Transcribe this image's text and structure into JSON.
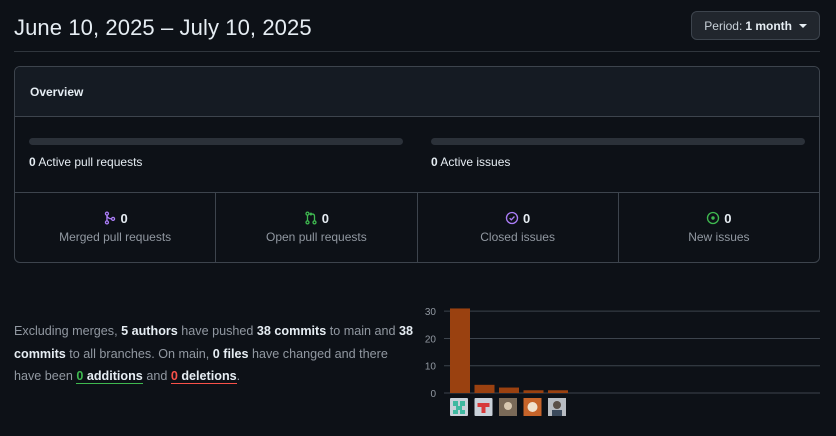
{
  "header": {
    "date_range": "June 10, 2025 – July 10, 2025",
    "period_label": "Period:",
    "period_value": "1 month"
  },
  "overview": {
    "title": "Overview",
    "active_pull_requests": {
      "count": "0",
      "label": "Active pull requests",
      "progress": 0
    },
    "active_issues": {
      "count": "0",
      "label": "Active issues",
      "progress": 0
    },
    "stats": [
      {
        "icon": "git-merge-icon",
        "color": "#ab7df8",
        "count": "0",
        "label": "Merged pull requests"
      },
      {
        "icon": "git-pull-request-icon",
        "color": "#3fb950",
        "count": "0",
        "label": "Open pull requests"
      },
      {
        "icon": "issue-closed-icon",
        "color": "#ab7df8",
        "count": "0",
        "label": "Closed issues"
      },
      {
        "icon": "issue-opened-icon",
        "color": "#3fb950",
        "count": "0",
        "label": "New issues"
      }
    ]
  },
  "summary": {
    "p1": "Excluding merges, ",
    "authors": "5 authors",
    "p2": " have pushed ",
    "commits_main": "38 commits",
    "p3": " to main and ",
    "commits_all": "38 commits",
    "p4": " to all branches. On main, ",
    "files": "0 files",
    "p5": " have changed and there have been ",
    "additions_n": "0",
    "additions_l": " additions",
    "p6": " and ",
    "deletions_n": "0",
    "deletions_l": " deletions",
    "p7": "."
  },
  "colors": {
    "bar": "#9a4110",
    "grid": "#3d444d",
    "tick": "#9198a1"
  },
  "chart_data": {
    "type": "bar",
    "categories": [
      "author-1",
      "author-2",
      "author-3",
      "author-4",
      "author-5"
    ],
    "values": [
      31,
      3,
      2,
      1,
      1
    ],
    "yticks": [
      0,
      10,
      20,
      30
    ],
    "ylim": [
      0,
      33
    ],
    "xlabel": "",
    "ylabel": "",
    "grid": true,
    "avatars": [
      "identicon-avatar",
      "red-logo-avatar",
      "photo-avatar",
      "dog-avatar",
      "person-avatar"
    ]
  }
}
